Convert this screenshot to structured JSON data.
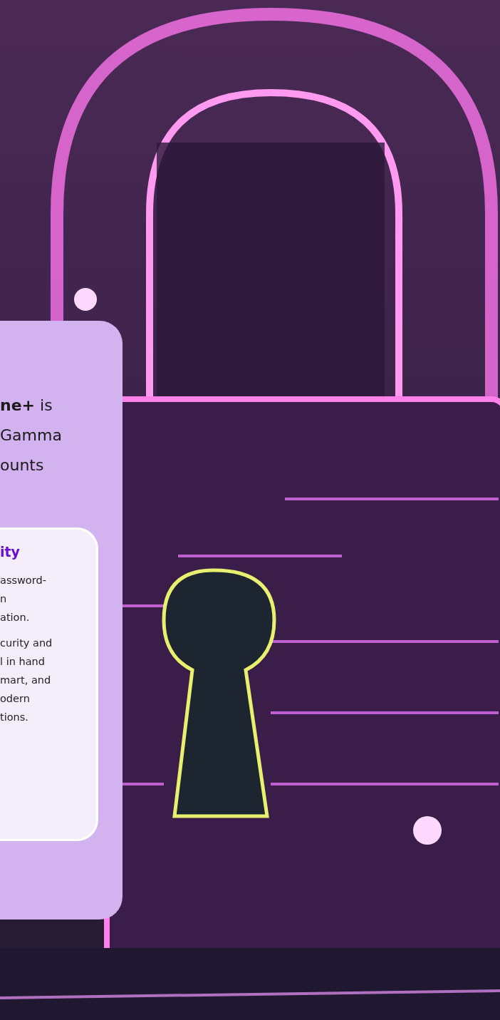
{
  "card": {
    "intro_lines": [
      "**ne+** is",
      "Gamma",
      "ounts"
    ],
    "feature": {
      "title": "ity",
      "paragraphs": [
        [
          "assword-",
          "n",
          "ation."
        ],
        [
          "curity and",
          "l in hand",
          "mart, and",
          "odern",
          "tions."
        ]
      ]
    }
  }
}
